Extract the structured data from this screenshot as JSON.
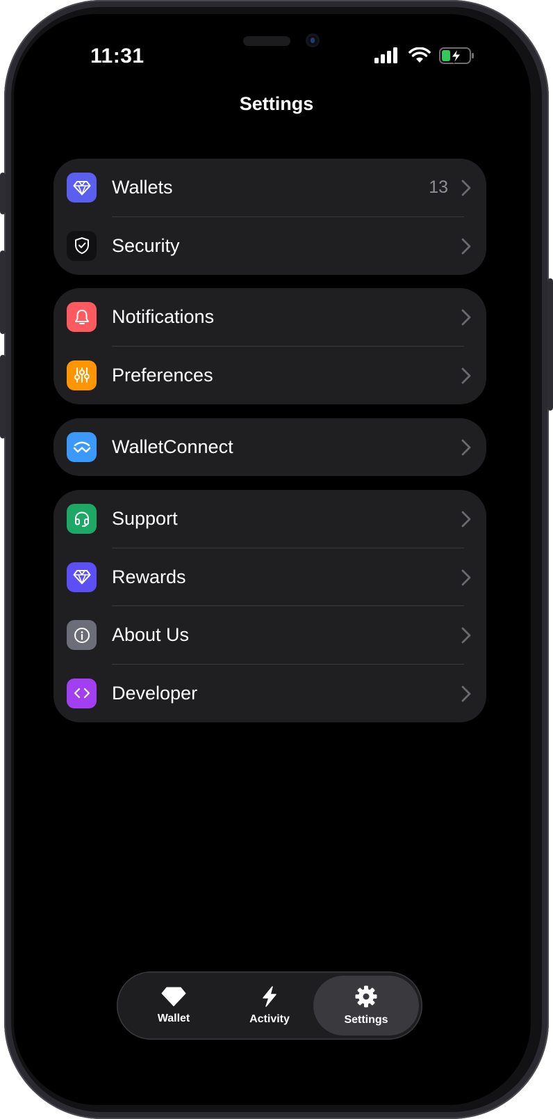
{
  "status_bar": {
    "time": "11:31"
  },
  "header": {
    "title": "Settings"
  },
  "groups": [
    {
      "rows": [
        {
          "label": "Wallets",
          "value": "13",
          "icon": "diamond-icon",
          "icon_bg": "#5b5ff0"
        },
        {
          "label": "Security",
          "value": "",
          "icon": "shield-check-icon",
          "icon_bg": "#111114"
        }
      ]
    },
    {
      "rows": [
        {
          "label": "Notifications",
          "icon": "bell-icon",
          "icon_bg": "#ff5a5f"
        },
        {
          "label": "Preferences",
          "icon": "sliders-icon",
          "icon_bg": "#ff9500"
        }
      ]
    },
    {
      "rows": [
        {
          "label": "WalletConnect",
          "icon": "walletconnect-icon",
          "icon_bg": "#3b99fc"
        }
      ]
    },
    {
      "rows": [
        {
          "label": "Support",
          "icon": "headset-icon",
          "icon_bg": "#1ea866"
        },
        {
          "label": "Rewards",
          "icon": "diamond-icon",
          "icon_bg": "#5b4ff5"
        },
        {
          "label": "About Us",
          "icon": "info-icon",
          "icon_bg": "#6b6e78"
        },
        {
          "label": "Developer",
          "icon": "code-icon",
          "icon_bg": "#a33ff2"
        }
      ]
    }
  ],
  "tabbar": {
    "tabs": [
      {
        "label": "Wallet",
        "icon": "diamond-icon"
      },
      {
        "label": "Activity",
        "icon": "lightning-icon"
      },
      {
        "label": "Settings",
        "icon": "gear-icon",
        "active": true
      }
    ]
  }
}
